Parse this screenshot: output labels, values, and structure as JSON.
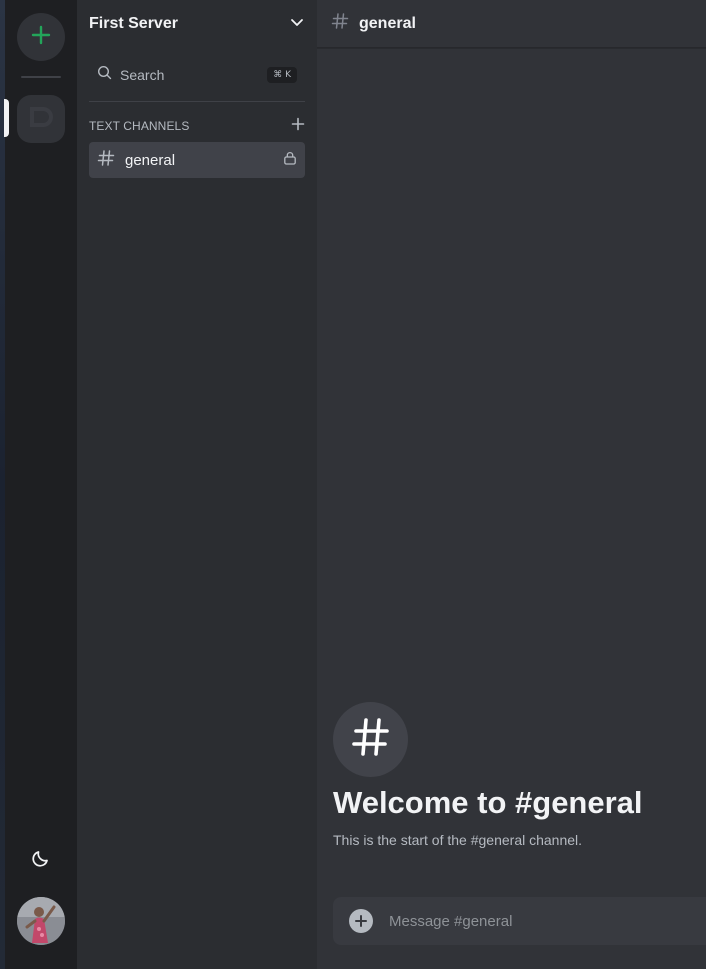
{
  "server": {
    "name": "First Server"
  },
  "search": {
    "label": "Search",
    "shortcut": "⌘ K"
  },
  "sidebar": {
    "category_label": "TEXT CHANNELS",
    "channels": [
      {
        "name": "general",
        "selected": true,
        "locked": true
      }
    ]
  },
  "channel": {
    "name": "general",
    "welcome_title": "Welcome to #general",
    "welcome_subtitle": "This is the start of the #general channel."
  },
  "composer": {
    "placeholder": "Message #general"
  },
  "icons": {
    "add_server": "plus-icon",
    "server": "server-logo-icon",
    "theme": "moon-icon",
    "header_chevron": "chevron-down-icon",
    "search": "search-icon",
    "add_channel": "plus-icon",
    "channel": "hash-icon",
    "lock": "lock-icon",
    "composer_add": "plus-circle-icon"
  },
  "colors": {
    "accent_green": "#23a55a",
    "selected_channel_bg": "#404249",
    "rail_bg": "#1e1f22",
    "sidebar_bg": "#2b2d31",
    "main_bg": "#313338"
  }
}
